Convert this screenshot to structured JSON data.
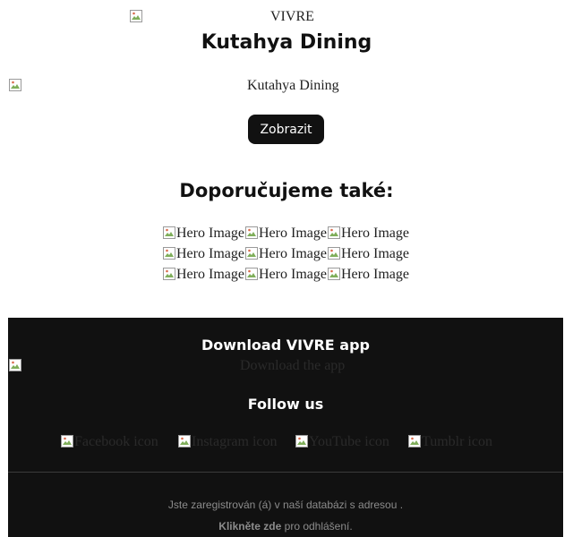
{
  "header": {
    "logo_alt": "VIVRE",
    "restaurant_name": "Kutahya Dining",
    "hero_alt": "Kutahya Dining",
    "show_button": "Zobrazit"
  },
  "recommendations": {
    "heading": "Doporučujeme také:",
    "image_alt": "Hero Image"
  },
  "footer": {
    "download_title": "Download VIVRE app",
    "download_alt": "Download the app",
    "follow_title": "Follow us",
    "social": {
      "facebook_alt": "Facebook icon",
      "instagram_alt": "Instagram icon",
      "youtube_alt": "YouTube icon",
      "tumblr_alt": "Tumblr icon"
    },
    "registered_text": "Jste zaregistrován (á) v naší databázi s adresou .",
    "unsubscribe_link": "Klikněte zde",
    "unsubscribe_rest": " pro odhlášení."
  },
  "colors": {
    "footer_bg": "#111111",
    "button_bg": "#111111",
    "footer_text": "#8c8c8c"
  }
}
